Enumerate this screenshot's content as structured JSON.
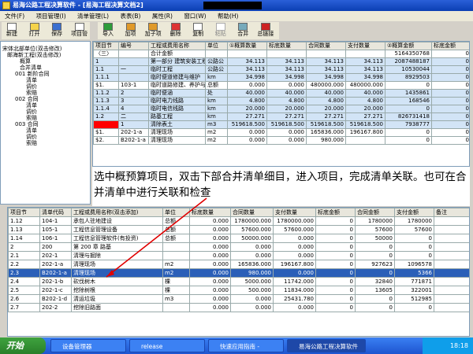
{
  "window": {
    "title": "易海公路工程决算软件 - [易海工程决算文档2]"
  },
  "menu": [
    "文件(F)",
    "项目管理(I)",
    "清单管理(L)",
    "表表(B)",
    "属性(R)",
    "窗口(W)",
    "帮助(H)"
  ],
  "toolbar_left": [
    "新建",
    "打开",
    "保存",
    "项目管"
  ],
  "toolbar_right": [
    "导入",
    "加项",
    "加子项",
    "删除",
    "复制",
    "粘贴",
    "合并",
    "总链接"
  ],
  "tree": [
    "宋体北部单位(双击修改)",
    "邮海新工程(双击修改)",
    "概算",
    "合并清单",
    "001 新阶合同",
    "清单",
    "调价",
    "索赔",
    "002 合同",
    "清单",
    "调价",
    "索赔",
    "003 合同",
    "清单",
    "调价",
    "索赔"
  ],
  "top_grid": {
    "headers": [
      "项目节",
      "编号",
      "工程或费用名称",
      "单位",
      "①概算数量",
      "标底数量",
      "合同数量",
      "支付数量",
      "②概算金额",
      "标底金额"
    ],
    "rows": [
      [
        "〈三〉",
        "",
        "合计金额",
        "",
        "",
        "",
        "",
        "",
        "5164350768",
        "0"
      ],
      [
        "1",
        "",
        "第一部分 建筑安装工程",
        "公路公",
        "34.113",
        "34.113",
        "34.113",
        "34.113",
        "2087488187",
        "0"
      ],
      [
        "1.1",
        "一",
        "临时工程",
        "公路公",
        "34.113",
        "34.113",
        "34.113",
        "34.113",
        "10530044",
        "0"
      ],
      [
        "1.1.1",
        "",
        "临时便道修建与维护",
        "km",
        "34.998",
        "34.998",
        "34.998",
        "34.998",
        "8929503",
        "0"
      ],
      [
        "$1.",
        "103-1",
        "临时道路修建、养护与拆除",
        "总额",
        "0.000",
        "0.000",
        "480000.000",
        "480000.000",
        "0",
        "0"
      ],
      [
        "1.1.2",
        "2",
        "临时便涵",
        "处",
        "40.000",
        "40.000",
        "40.000",
        "40.000",
        "1435861",
        "0"
      ],
      [
        "1.1.3",
        "3",
        "临时电力线路",
        "km",
        "4.800",
        "4.800",
        "4.800",
        "4.800",
        "168546",
        "0"
      ],
      [
        "1.1.4",
        "4",
        "临时电信线路",
        "km",
        "20.000",
        "20.000",
        "20.000",
        "20.000",
        "0",
        "0"
      ],
      [
        "1.2",
        "二",
        "路基工程",
        "km",
        "27.271",
        "27.271",
        "27.271",
        "27.271",
        "826731418",
        "0"
      ],
      [
        "",
        "1",
        "清除表土",
        "m3",
        "519618.500",
        "519618.500",
        "519618.500",
        "519618.500",
        "7938777",
        "0"
      ],
      [
        "$1.",
        "202-1-a",
        "清理现场",
        "m2",
        "0.000",
        "0.000",
        "165836.000",
        "196167.800",
        "0",
        "0"
      ],
      [
        "$2.",
        "B202-1-a",
        "清理现场",
        "m2",
        "0.000",
        "0.000",
        "980.000",
        "",
        "0",
        "0"
      ]
    ]
  },
  "callout": "选中概预算项目，双击下部合并清单细目，进入项目，完成清单关联。也可在合并清单中进行关联和检查",
  "bottom_grid": {
    "headers": [
      "项目节",
      "清单代码",
      "工程或费用名称(双击添加)",
      "单位",
      "标底数量",
      "合同数量",
      "支付数量",
      "标底金额",
      "合同金额",
      "支付金额",
      "备注"
    ],
    "rows": [
      [
        "1.12",
        "104-1",
        "承包人驻地建设",
        "总额",
        "0.000",
        "1780000.000",
        "1780000.000",
        "0",
        "1780000",
        "1780000",
        ""
      ],
      [
        "1.13",
        "105-1",
        "工程信息管理设备",
        "总额",
        "0.000",
        "57600.000",
        "57600.000",
        "0",
        "57600",
        "57600",
        ""
      ],
      [
        "1.14",
        "106-1",
        "工程信息管理软件(有投资)",
        "总额",
        "0.000",
        "50000.000",
        "0.000",
        "0",
        "50000",
        "0",
        ""
      ],
      [
        "2",
        "200",
        "第 200 章 路基",
        "",
        "0.000",
        "0.000",
        "0.000",
        "0",
        "0",
        "0",
        ""
      ],
      [
        "2.1",
        "202-1",
        "清理与掘除",
        "",
        "0.000",
        "0.000",
        "0.000",
        "0",
        "0",
        "0",
        ""
      ],
      [
        "2.2",
        "202-1-a",
        "清理现场",
        "m2",
        "0.000",
        "165836.000",
        "196167.800",
        "0",
        "927623",
        "1096578",
        ""
      ],
      [
        "2.3",
        "B202-1-a",
        "清理现场",
        "m2",
        "0.000",
        "980.000",
        "0.000",
        "0",
        "0",
        "5366",
        ""
      ],
      [
        "2.4",
        "202-1-b",
        "砍伐树木",
        "棵",
        "0.000",
        "5000.000",
        "11742.000",
        "0",
        "32840",
        "771871",
        ""
      ],
      [
        "2.5",
        "202-1-c",
        "挖除树根",
        "棵",
        "0.000",
        "500.000",
        "11834.000",
        "0",
        "13605",
        "322001",
        ""
      ],
      [
        "2.6",
        "B202-1-d",
        "清运垃圾",
        "m3",
        "0.000",
        "0.000",
        "25431.780",
        "0",
        "0",
        "512985",
        ""
      ],
      [
        "2.7",
        "202-2",
        "挖除旧路面",
        "",
        "0.000",
        "0.000",
        "0.000",
        "0",
        "0",
        "0",
        ""
      ]
    ]
  },
  "taskbar": {
    "start": "开始",
    "tasks": [
      "设备管理器",
      "release",
      "快速应用指南 -",
      "易海公路工程决算软件"
    ],
    "clock": "18:18"
  }
}
